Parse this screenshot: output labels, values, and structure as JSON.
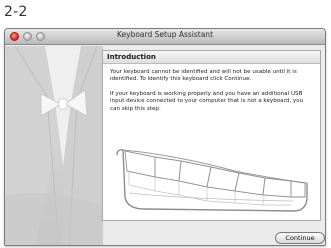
{
  "caption": "2-2",
  "window": {
    "title": "Keyboard Setup Assistant"
  },
  "panel": {
    "heading": "Introduction",
    "paragraph1": "Your keyboard cannot be identified and will not be usable until it is identified. To identify this keyboard click Continue.",
    "paragraph2": "If your keyboard is working properly and you have an additional USB input device connected to your computer that is not a keyboard, you can skip this step."
  },
  "buttons": {
    "continue": "Continue"
  },
  "icons": {
    "close": "close-dot-icon",
    "minimize": "minimize-dot-icon",
    "zoom": "zoom-dot-icon",
    "keyboard": "keyboard-illustration"
  }
}
